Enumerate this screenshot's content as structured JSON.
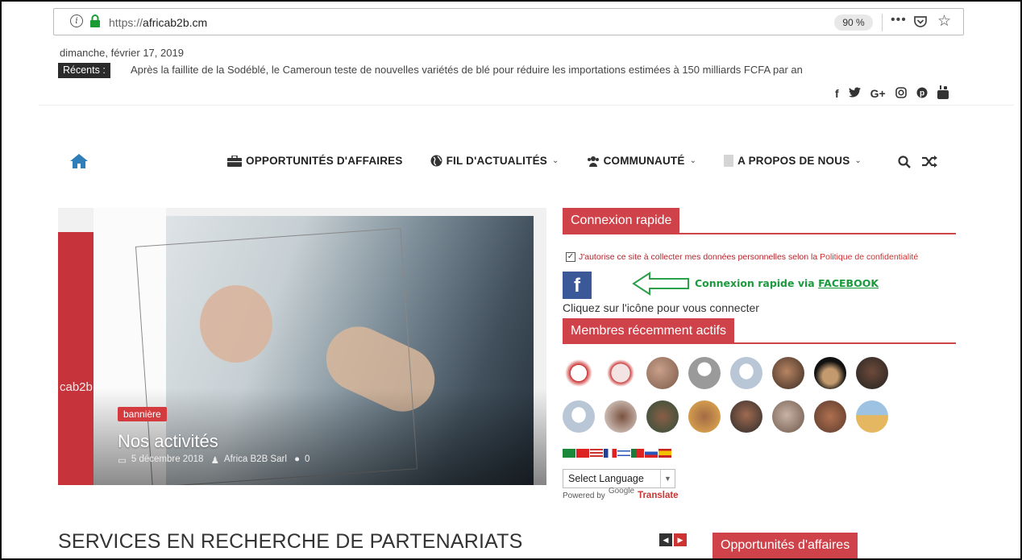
{
  "browser": {
    "url_scheme": "https://",
    "url_host": "africab2b.cm",
    "zoom": "90 %",
    "more": "•••"
  },
  "header": {
    "date": "dimanche, février 17, 2019",
    "recents_label": "Récents :",
    "ticker": "Après la faillite de la Sodéblé, le Cameroun teste de nouvelles variétés de blé pour réduire les importations estimées à 150 milliards FCFA par an",
    "social": [
      "f",
      "🐦",
      "G+",
      "◎",
      "℗",
      "▶"
    ]
  },
  "nav": {
    "items": [
      {
        "label": "OPPORTUNITÉS D'AFFAIRES"
      },
      {
        "label": "FIL D'ACTUALITÉS"
      },
      {
        "label": "COMMUNAUTÉ"
      },
      {
        "label": "A PROPOS DE NOUS"
      }
    ],
    "chevron": "⌄"
  },
  "hero": {
    "side_text": "cab2b",
    "tag": "bannière",
    "title": "Nos activités",
    "date": "5 décembre 2018",
    "author": "Africa B2B Sarl",
    "comments": "0"
  },
  "sidebar": {
    "quick_login": "Connexion rapide",
    "consent_text": "J'autorise ce site à collecter mes données personnelles selon la",
    "consent_link": "Politique de confidentialité",
    "fb_letter": "f",
    "fb_label_prefix": "Connexion rapide via ",
    "fb_label_link": "FACEBOOK",
    "click_text": "Cliquez sur l'icône pour vous connecter",
    "members_title": "Membres récemment actifs",
    "language": "Select Language",
    "powered_by": "Powered by",
    "google": "Google",
    "translate": "Translate",
    "opportunities_title": "Opportunités d'affaires"
  },
  "main": {
    "section_title": "SERVICES EN RECHERCHE DE PARTENARIATS"
  },
  "colors": {
    "accent": "#d0424a",
    "facebook": "#3b5998",
    "green": "#1b9a3e"
  }
}
